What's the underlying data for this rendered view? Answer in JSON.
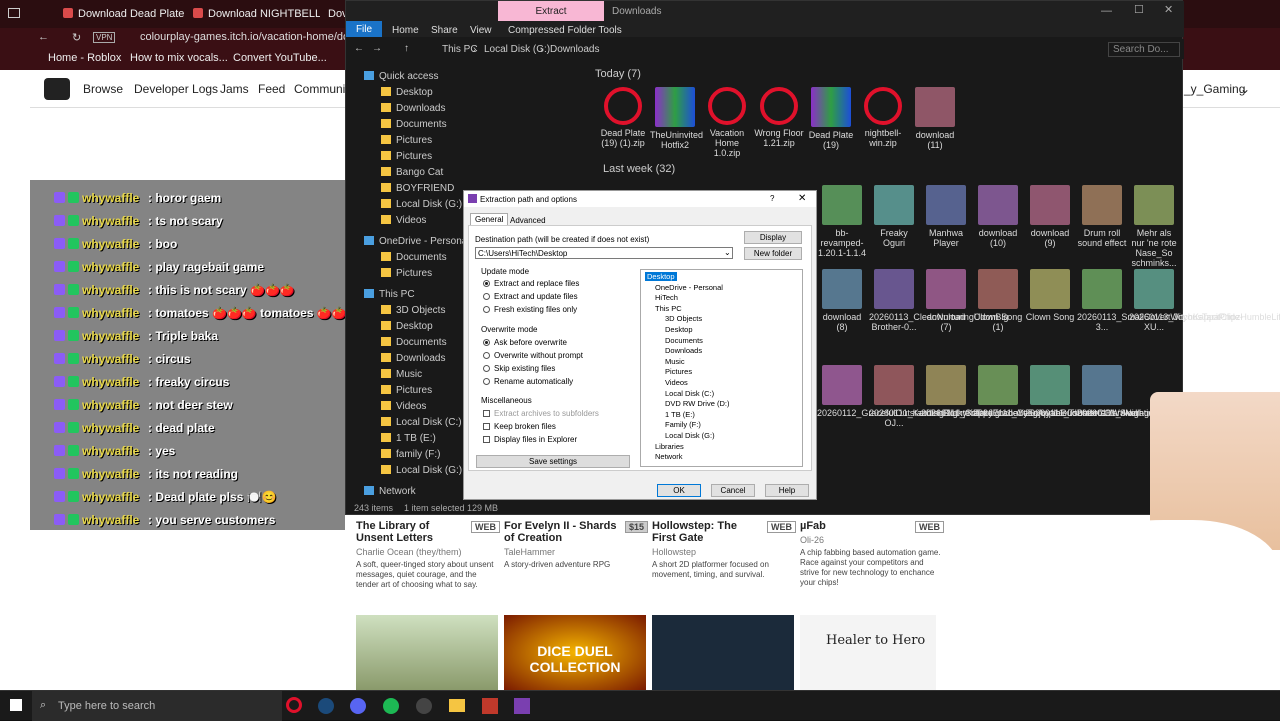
{
  "browser": {
    "tabs": [
      "Download Dead Plate by r",
      "Download NIGHTBELL by",
      "Dov"
    ],
    "address_vpn": "VPN",
    "url": "colourplay-games.itch.io/vacation-home/downlo",
    "bookmarks": [
      "Home - Roblox",
      "How to mix vocals...",
      "Convert YouTube..."
    ],
    "itch_nav": [
      "Browse",
      "Developer Logs",
      "Jams",
      "Feed",
      "Communit"
    ],
    "user_label": "_y_Gaming",
    "games": [
      {
        "title": "The Library of Unsent Letters",
        "badge": "WEB",
        "author": "Charlie Ocean (they/them)",
        "desc": "A soft, queer-tinged story about unsent messages, quiet courage, and the tender art of choosing what to say."
      },
      {
        "title": "For Evelyn II - Shards of Creation",
        "badge": "$15",
        "author": "TaleHammer",
        "desc": "A story-driven adventure RPG"
      },
      {
        "title": "Hollowstep: The First Gate",
        "badge": "WEB",
        "author": "Hollowstep",
        "desc": "A short 2D platformer focused on movement, timing, and survival."
      },
      {
        "title": "µFab",
        "badge": "WEB",
        "author": "Oli-26",
        "desc": "A chip fabbing based automation game. Race against your competitors and strive for new technology to enchance your chips!"
      }
    ],
    "game_thumb_text": {
      "dice": "DICE DUEL COLLECTION",
      "healer": "Healer to Hero"
    }
  },
  "chat": [
    {
      "user": "whywaffle",
      "msg": ": horor gaem"
    },
    {
      "user": "whywaffle",
      "msg": ": ts not scary"
    },
    {
      "user": "whywaffle",
      "msg": ": boo"
    },
    {
      "user": "whywaffle",
      "msg": ": play ragebait game"
    },
    {
      "user": "whywaffle",
      "msg": ": this is not scary 🍅🍅🍅"
    },
    {
      "user": "whywaffle",
      "msg": ": tomatoes 🍅🍅🍅 tomatoes 🍅🍅🍅"
    },
    {
      "user": "whywaffle",
      "msg": ": Triple baka"
    },
    {
      "user": "whywaffle",
      "msg": ": circus"
    },
    {
      "user": "whywaffle",
      "msg": ": freaky circus"
    },
    {
      "user": "whywaffle",
      "msg": ": not deer stew"
    },
    {
      "user": "whywaffle",
      "msg": ": dead plate"
    },
    {
      "user": "whywaffle",
      "msg": ": yes"
    },
    {
      "user": "whywaffle",
      "msg": ": its not reading"
    },
    {
      "user": "whywaffle",
      "msg": ": Dead plate plss 🍽️😊"
    },
    {
      "user": "whywaffle",
      "msg": ": you serve customers"
    }
  ],
  "explorer": {
    "context_tab": "Extract",
    "title": "Downloads",
    "ribbon_tabs": [
      "File",
      "Home",
      "Share",
      "View",
      "Compressed Folder Tools"
    ],
    "path": [
      "This PC",
      "Local Disk (G:)",
      "Downloads"
    ],
    "search_placeholder": "Search Do...",
    "nav": [
      {
        "label": "Quick access",
        "indent": 0
      },
      {
        "label": "Desktop",
        "indent": 1
      },
      {
        "label": "Downloads",
        "indent": 1
      },
      {
        "label": "Documents",
        "indent": 1
      },
      {
        "label": "Pictures",
        "indent": 1
      },
      {
        "label": "Pictures",
        "indent": 1
      },
      {
        "label": "Bango Cat",
        "indent": 1
      },
      {
        "label": "BOYFRIEND",
        "indent": 1
      },
      {
        "label": "Local Disk (G:)",
        "indent": 1
      },
      {
        "label": "Videos",
        "indent": 1
      },
      {
        "label": "OneDrive - Personal",
        "indent": 0
      },
      {
        "label": "Documents",
        "indent": 1
      },
      {
        "label": "Pictures",
        "indent": 1
      },
      {
        "label": "This PC",
        "indent": 0
      },
      {
        "label": "3D Objects",
        "indent": 1
      },
      {
        "label": "Desktop",
        "indent": 1
      },
      {
        "label": "Documents",
        "indent": 1
      },
      {
        "label": "Downloads",
        "indent": 1
      },
      {
        "label": "Music",
        "indent": 1
      },
      {
        "label": "Pictures",
        "indent": 1
      },
      {
        "label": "Videos",
        "indent": 1
      },
      {
        "label": "Local Disk (C:)",
        "indent": 1
      },
      {
        "label": "1 TB (E:)",
        "indent": 1
      },
      {
        "label": "family (F:)",
        "indent": 1
      },
      {
        "label": "Local Disk (G:)",
        "indent": 1
      },
      {
        "label": "Network",
        "indent": 0
      }
    ],
    "status": {
      "count": "243 items",
      "selected": "1 item selected  129 MB"
    },
    "groups": {
      "today": "Today (7)",
      "lastweek": "Last week (32)"
    },
    "today_files": [
      "Dead Plate (19) (1).zip",
      "TheUninvited Hotfix2",
      "Vacation Home 1.0.zip",
      "Wrong Floor 1.21.zip",
      "Dead Plate (19)",
      "nightbell-win.zip",
      "download (11)"
    ],
    "row1_files": [
      "bb-revamped-1.20.1-1.1.4",
      "Freaky Oguri",
      "Manhwa Player",
      "download (10)",
      "download (9)",
      "Drum roll sound effect",
      "Mehr als nur 'ne rote Nase_So schminks..."
    ],
    "row2_files": [
      "download (8)",
      "20260113_CleanNurturingUdonBig Brother-0...",
      "download (7)",
      "Clown Song (1)",
      "Clown Song",
      "20260113_SmallCovertWitchKappaPride-3...",
      "20260113_JoyousTacitClipzHumbleLife-XU..."
    ],
    "row3_files": [
      "20260112_GracefulOutstandingPorkyKappa...",
      "20260111_KathishBlightedTardigradeYee-OJ...",
      "20260111_CrackyEnchantingAppleBudBlast-...",
      "20260111_CyEnjoyableLobsterGOWSkulli-...",
      "20260111_TsundereHardNightingaleRitzMitz...",
      "20260111_AverageAbrasiveRavenDatSheffy-..."
    ]
  },
  "dialog": {
    "title": "Extraction path and options",
    "tabs": [
      "General",
      "Advanced"
    ],
    "dest_label": "Destination path (will be created if does not exist)",
    "dest_value": "C:\\Users\\HiTech\\Desktop",
    "btn_display": "Display",
    "btn_newfolder": "New folder",
    "update_mode_label": "Update mode",
    "update_modes": [
      "Extract and replace files",
      "Extract and update files",
      "Fresh existing files only"
    ],
    "overwrite_label": "Overwrite mode",
    "overwrite_modes": [
      "Ask before overwrite",
      "Overwrite without prompt",
      "Skip existing files",
      "Rename automatically"
    ],
    "misc_label": "Miscellaneous",
    "misc": [
      "Extract archives to subfolders",
      "Keep broken files",
      "Display files in Explorer"
    ],
    "save_settings": "Save settings",
    "tree": [
      {
        "label": "Desktop",
        "lvl": 0
      },
      {
        "label": "OneDrive - Personal",
        "lvl": 1
      },
      {
        "label": "HiTech",
        "lvl": 1
      },
      {
        "label": "This PC",
        "lvl": 1
      },
      {
        "label": "3D Objects",
        "lvl": 2
      },
      {
        "label": "Desktop",
        "lvl": 2
      },
      {
        "label": "Documents",
        "lvl": 2
      },
      {
        "label": "Downloads",
        "lvl": 2
      },
      {
        "label": "Music",
        "lvl": 2
      },
      {
        "label": "Pictures",
        "lvl": 2
      },
      {
        "label": "Videos",
        "lvl": 2
      },
      {
        "label": "Local Disk (C:)",
        "lvl": 2
      },
      {
        "label": "DVD RW Drive (D:)",
        "lvl": 2
      },
      {
        "label": "1 TB (E:)",
        "lvl": 2
      },
      {
        "label": "Family (F:)",
        "lvl": 2
      },
      {
        "label": "Local Disk (G:)",
        "lvl": 2
      },
      {
        "label": "Libraries",
        "lvl": 1
      },
      {
        "label": "Network",
        "lvl": 1
      }
    ],
    "ok": "OK",
    "cancel": "Cancel",
    "help": "Help",
    "help_glyph": "?",
    "close_glyph": "✕"
  },
  "taskbar": {
    "search_placeholder": "Type here to search"
  },
  "colors": {
    "accent_red": "#e0112b",
    "explorer_bg": "#191919",
    "chat_user": "#e6d64a",
    "selection": "#0078d7"
  }
}
